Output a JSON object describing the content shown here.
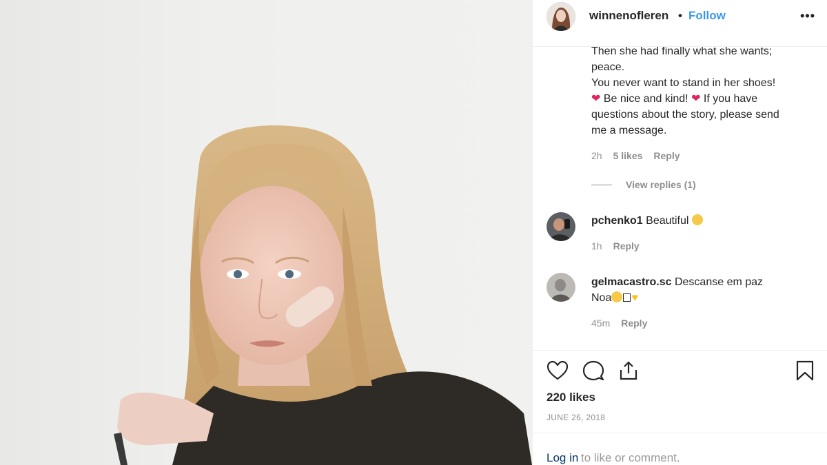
{
  "header": {
    "username": "winnenofleren",
    "separator": "•",
    "follow_label": "Follow",
    "more_label": "•••"
  },
  "comments": [
    {
      "lines": [
        "Then she had finally what she wants;",
        "peace.",
        "You never want to stand in her shoes!",
        "Be nice and kind!",
        "If you have",
        "questions about the story, please send",
        "me a message."
      ],
      "time": "2h",
      "likes": "5 likes",
      "reply": "Reply",
      "view_replies": "View replies (1)"
    },
    {
      "username": "pchenko1",
      "text": "Beautiful",
      "time": "1h",
      "reply": "Reply"
    },
    {
      "username": "gelmacastro.sc",
      "text": "Descanse em paz",
      "text2": "Noa",
      "time": "45m",
      "reply": "Reply"
    }
  ],
  "actions": {
    "likes": "220 likes",
    "date": "JUNE 26, 2018",
    "icons": [
      "heart-icon",
      "comment-icon",
      "share-icon",
      "bookmark-icon"
    ]
  },
  "login": {
    "link": "Log in",
    "rest": "to like or comment."
  },
  "colors": {
    "accent": "#3897f0",
    "link_dark": "#003569",
    "muted": "#8e8e8e",
    "heart": "#e0245e"
  }
}
